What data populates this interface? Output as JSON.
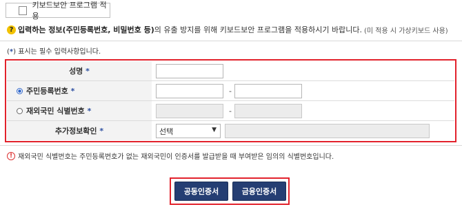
{
  "keyboard_security": {
    "label": "키보드보안 프로그램 적용",
    "checked": false
  },
  "notice": {
    "bold": "입력하는 정보(주민등록번호, 비밀번호 등)",
    "text": "의 유출 방지를 위해 키보드보안 프로그램을 적용하시기 바랍니다.",
    "small": "(미 적용 시 가상키보드 사용)"
  },
  "required_note": {
    "prefix": "(",
    "star": "*",
    "suffix": ") 표시는 필수 입력사항입니다."
  },
  "form": {
    "name": {
      "label": "성명",
      "value": ""
    },
    "rrn": {
      "label": "주민등록번호",
      "selected": true,
      "first": "",
      "second": "",
      "separator": "-"
    },
    "foreigner": {
      "label": "재외국민 식별번호",
      "selected": false,
      "first": "",
      "second": "",
      "separator": "-"
    },
    "extra": {
      "label": "추가정보확인",
      "select_value": "선택",
      "input": ""
    },
    "required_star": "*"
  },
  "warning": "재외국민 식별번호는 주민등록번호가 없는 재외국민이 인증서를 발급받을 때 부여받은 임의의 식별번호입니다.",
  "buttons": {
    "joint_cert": "공동인증서",
    "financial_cert": "금융인증서"
  },
  "colors": {
    "accent": "#253e73",
    "highlight": "#e2212b",
    "required": "#2d4fa1"
  }
}
